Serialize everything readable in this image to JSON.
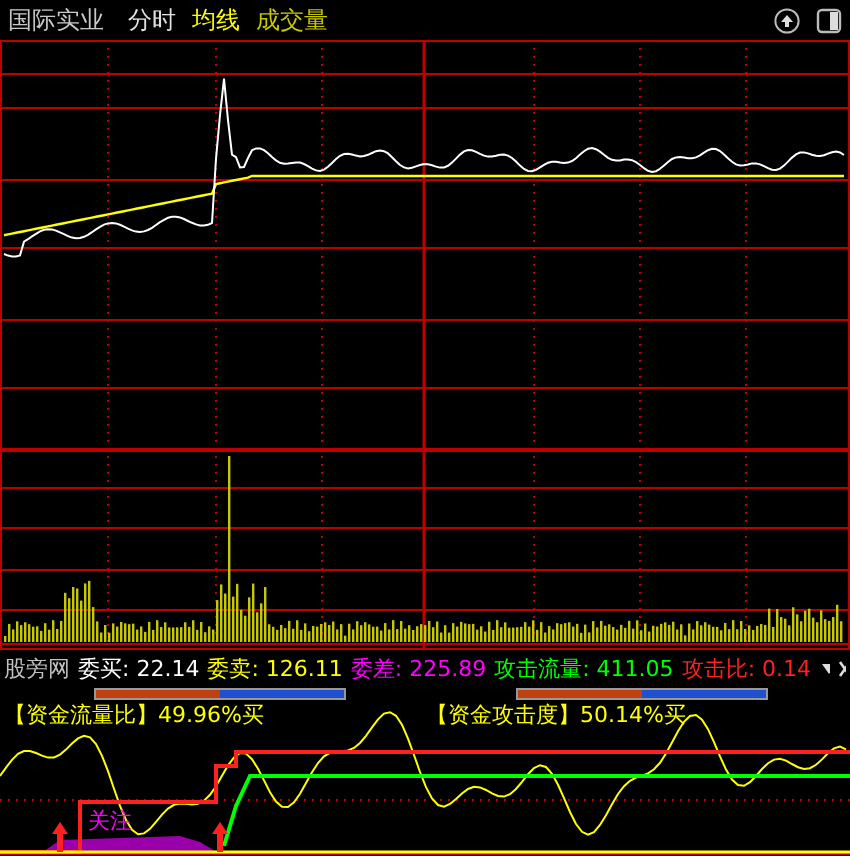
{
  "header": {
    "title": "国际实业",
    "legend": [
      {
        "label": "分时",
        "color": "#e0e0e0"
      },
      {
        "label": "均线",
        "color": "#ffff00"
      },
      {
        "label": "成交量",
        "color": "#c8c800"
      }
    ]
  },
  "stats": [
    {
      "label": "股旁网",
      "color": "#c0c0c0"
    },
    {
      "label": "委买: 22.14",
      "color": "#ffffff"
    },
    {
      "label": "委卖: 126.11",
      "color": "#ffff00"
    },
    {
      "label": "委差: 225.89",
      "color": "#ff00ff"
    },
    {
      "label": "攻击流量: 411.05",
      "color": "#00ff00"
    },
    {
      "label": "攻击比: 0.14",
      "color": "#ff2020"
    }
  ],
  "indicators": [
    {
      "label": "【资金流量比】49.96%买",
      "level": 0.4996
    },
    {
      "label": "【资金攻击度】50.14%买",
      "level": 0.5014
    }
  ],
  "markers": [
    {
      "label": "关注"
    }
  ]
}
